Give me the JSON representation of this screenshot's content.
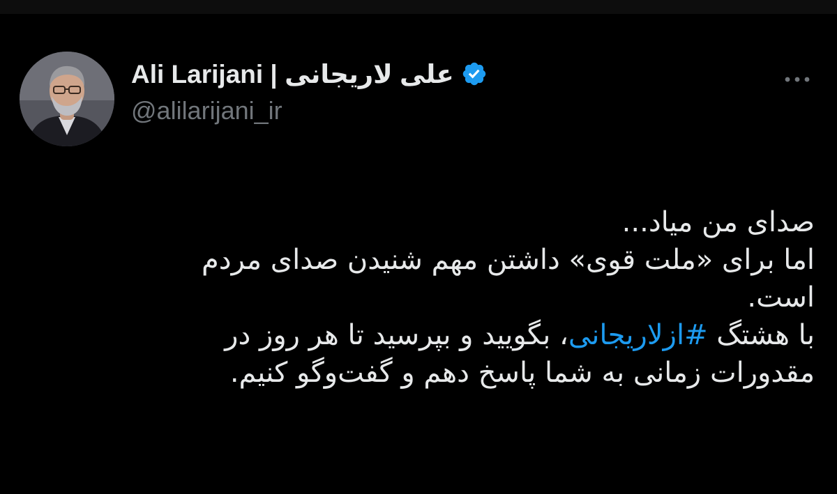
{
  "author": {
    "name": "Ali Larijani | علی لاریجانی",
    "handle": "@alilarijani_ir",
    "verified": true,
    "avatar_icon": "profile-photo"
  },
  "menu": {
    "more_label": "•••",
    "more_icon": "more-horizontal-icon"
  },
  "tweet": {
    "lines": [
      "صدای من میاد...",
      "اما برای «ملت قوی» داشتن مهم شنیدن صدای مردم",
      "است."
    ],
    "line4_before": "با هشتگ ",
    "hashtag": "#ازلاریجانی",
    "line4_after": "، بگویید و بپرسید تا هر روز در",
    "line5": "مقدورات زمانی به شما پاسخ دهم و گفت‌وگو کنیم."
  },
  "colors": {
    "background": "#000000",
    "text": "#e7e9ea",
    "secondary": "#71767b",
    "accent": "#1d9bf0"
  }
}
